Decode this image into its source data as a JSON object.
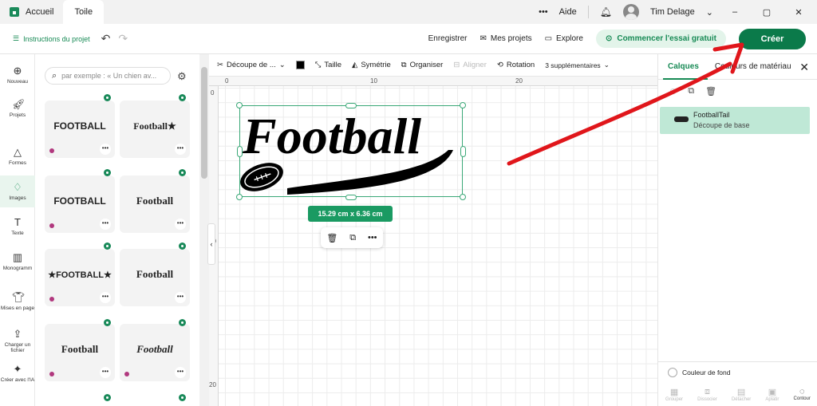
{
  "titlebar": {
    "home_label": "Accueil",
    "tab_label": "Toile",
    "more_label": "•••",
    "help_label": "Aide",
    "user_name": "Tim Delage",
    "minimize": "–",
    "restore": "▢",
    "close": "✕"
  },
  "header": {
    "instructions": "Instructions du projet",
    "save": "Enregistrer",
    "my_projects": "Mes projets",
    "explore": "Explore",
    "trial": "Commencer l'essai gratuit",
    "create": "Créer"
  },
  "rail": {
    "new": "Nouveau",
    "projects": "Projets",
    "shapes": "Formes",
    "images": "Images",
    "text": "Texte",
    "monogram": "Monogramm",
    "layouts": "Mises en page",
    "upload": "Charger un fichier",
    "ai": "Créer avec l'IA"
  },
  "images_panel": {
    "search_placeholder": "par exemple : « Un chien av...",
    "cards": [
      {
        "art": "FOOTBALL"
      },
      {
        "art": "Football★"
      },
      {
        "art": "FOOTBALL"
      },
      {
        "art": "Football"
      },
      {
        "art": "★FOOTBALL★"
      },
      {
        "art": "Football"
      },
      {
        "art": "Football"
      },
      {
        "art": "Football"
      }
    ]
  },
  "toolbar": {
    "cut_type": "Découpe de ...",
    "size": "Taille",
    "symmetry": "Symétrie",
    "organize": "Organiser",
    "align": "Aligner",
    "rotation": "Rotation",
    "more": "3 supplémentaires"
  },
  "canvas": {
    "ruler_labels": [
      "0",
      "10",
      "20"
    ],
    "ruler_v_labels": [
      "0",
      "10",
      "20"
    ],
    "design_text": "Football",
    "dimensions": "15.29  cm x 6.36  cm"
  },
  "right_panel": {
    "tab_layers": "Calques",
    "tab_colors": "Couleurs de matériau",
    "layer_name": "FootballTail",
    "layer_sub": "Découpe de base",
    "background_color": "Couleur de fond",
    "footer": [
      "Grouper",
      "Dissocier",
      "Détacher",
      "Aplatir",
      "Contour"
    ]
  },
  "colors": {
    "brand_green": "#0b7a4a",
    "selection": "#3aa877",
    "annotation_red": "#e0161b"
  }
}
